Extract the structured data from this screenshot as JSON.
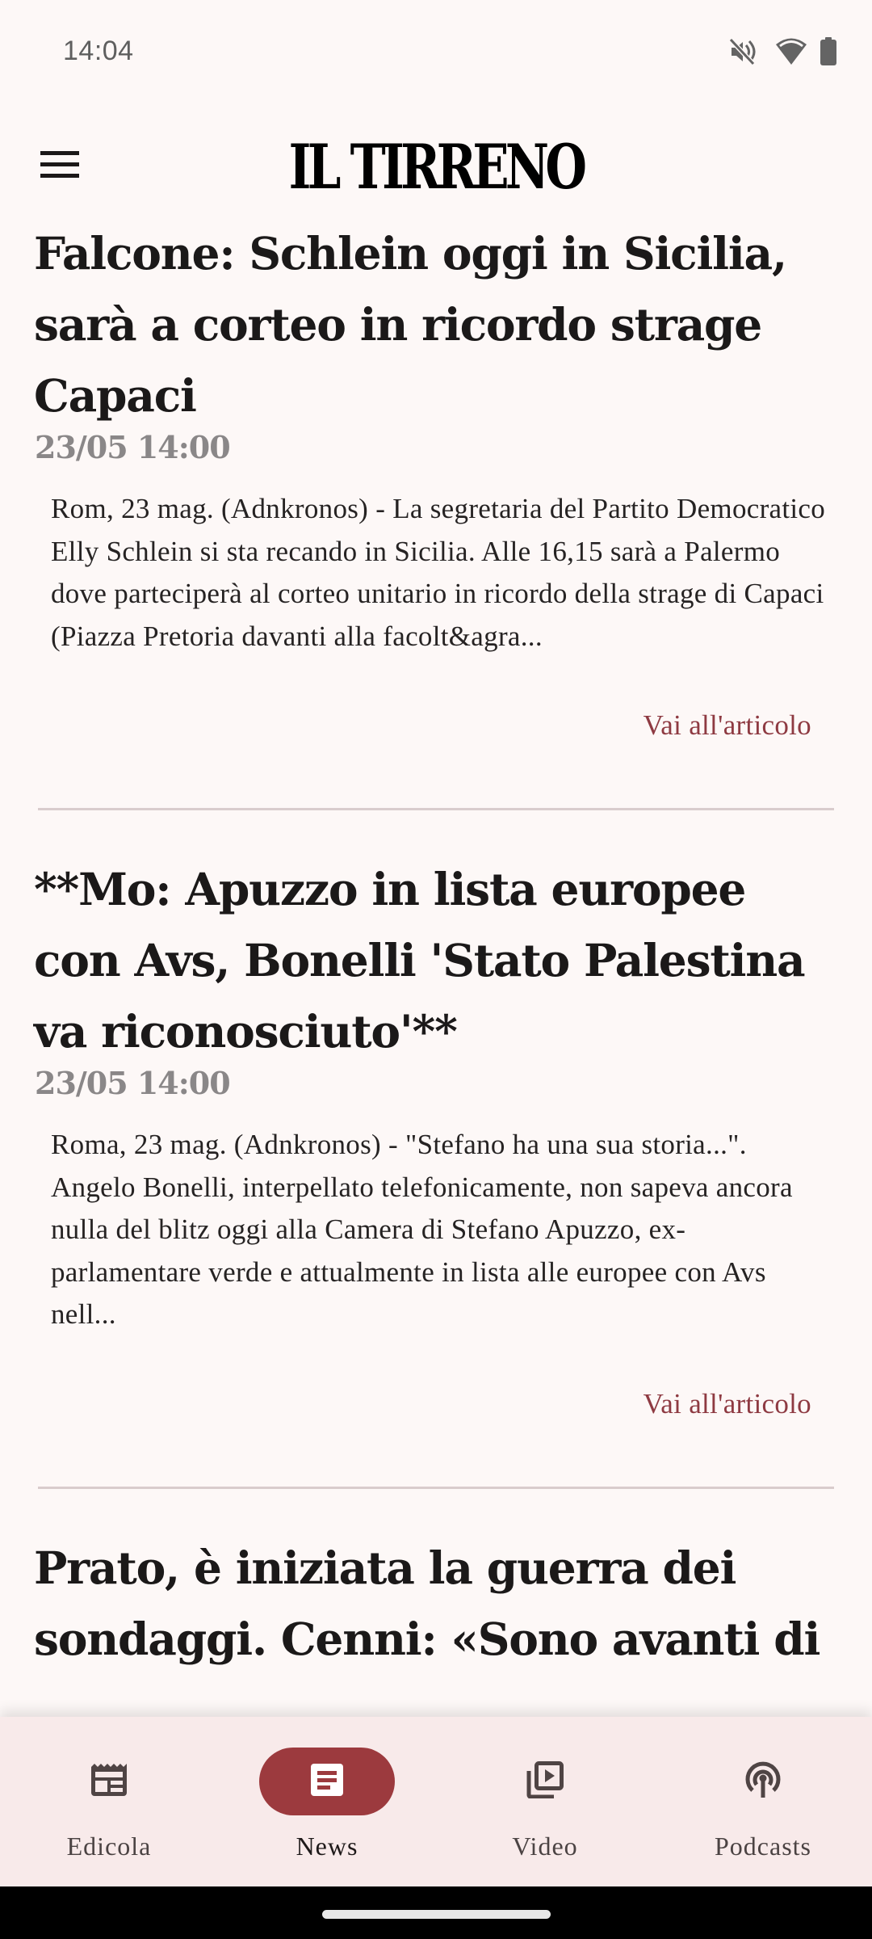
{
  "status_bar": {
    "time": "14:04",
    "icons": [
      "mute-icon",
      "wifi-icon",
      "battery-icon"
    ]
  },
  "header": {
    "logo_text": "IL TIRRENO",
    "menu_icon": "hamburger-menu-icon"
  },
  "articles": [
    {
      "headline": "Falcone: Schlein oggi in Sicilia, sarà a corteo in ricordo strage Capaci",
      "date": "23/05 14:00",
      "summary": "Rom, 23 mag. (Adnkronos) - La segretaria del Partito Democratico Elly Schlein si sta recando in Sicilia. Alle 16,15 sarà a Palermo dove parteciperà al corteo unitario in ricordo della strage di Capaci (Piazza Pretoria davanti alla facolt&agra...",
      "link_label": "Vai all'articolo"
    },
    {
      "headline": "**Mo: Apuzzo in lista europee con Avs, Bonelli 'Stato Palestina va riconosciuto'**",
      "date": "23/05 14:00",
      "summary": "Roma, 23 mag. (Adnkronos) - \"Stefano ha una sua storia...\". Angelo Bonelli, interpellato telefonicamente, non sapeva ancora nulla del blitz oggi alla Camera di Stefano Apuzzo, ex-parlamentare verde e attualmente in lista alle europee con Avs nell...",
      "link_label": "Vai all'articolo"
    },
    {
      "headline": "Prato, è iniziata la guerra dei sondaggi. Cenni: «Sono avanti di"
    }
  ],
  "bottom_nav": {
    "items": [
      {
        "label": "Edicola",
        "icon": "newspaper-icon",
        "active": false
      },
      {
        "label": "News",
        "icon": "article-icon",
        "active": true
      },
      {
        "label": "Video",
        "icon": "video-library-icon",
        "active": false
      },
      {
        "label": "Podcasts",
        "icon": "podcast-icon",
        "active": false
      }
    ]
  },
  "colors": {
    "accent": "#9c3a3e",
    "link": "#8e3a42",
    "background": "#fdf8f7",
    "nav_background": "#f8eaea",
    "date_gray": "#8a8788"
  }
}
